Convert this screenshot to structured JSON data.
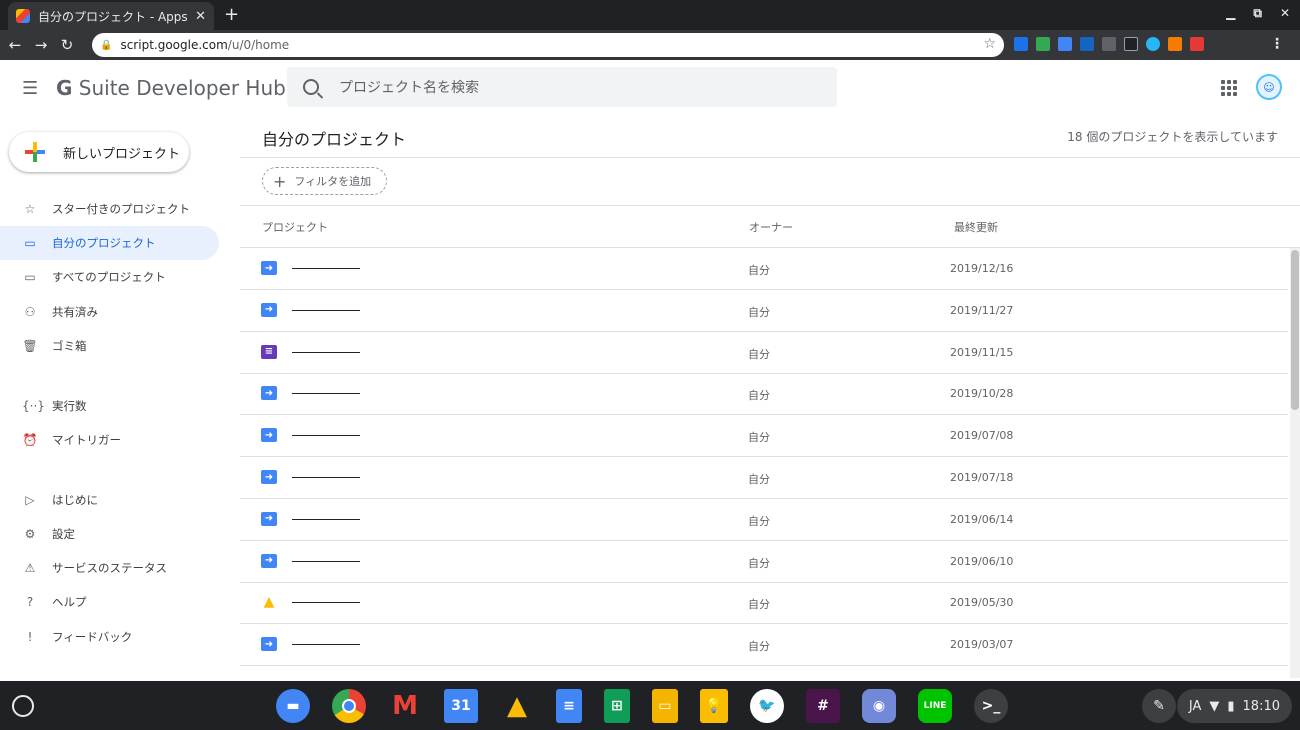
{
  "browser": {
    "tab_title": "自分のプロジェクト - Apps Sc",
    "tab_close": "✕",
    "new_tab": "+",
    "url_host": "script.google.com",
    "url_path": "/u/0/home",
    "window_controls": [
      "▁",
      "⧉",
      "✕"
    ]
  },
  "header": {
    "product_g": "G",
    "product_name": "Suite Developer Hub",
    "search_placeholder": "プロジェクト名を検索"
  },
  "sidebar": {
    "new_project_label": "新しいプロジェクト",
    "items": [
      {
        "icon": "star-icon",
        "glyph": "☆",
        "label": "スター付きのプロジェクト",
        "active": false
      },
      {
        "icon": "folder-icon",
        "glyph": "▭",
        "label": "自分のプロジェクト",
        "active": true
      },
      {
        "icon": "folder-icon",
        "glyph": "▭",
        "label": "すべてのプロジェクト",
        "active": false
      },
      {
        "icon": "people-icon",
        "glyph": "⚇",
        "label": "共有済み",
        "active": false
      },
      {
        "icon": "trash-icon",
        "glyph": "🗑",
        "label": "ゴミ箱",
        "active": false
      },
      {
        "icon": "executions-icon",
        "glyph": "{··}",
        "label": "実行数",
        "active": false
      },
      {
        "icon": "alarm-icon",
        "glyph": "⏰",
        "label": "マイトリガー",
        "active": false
      },
      {
        "icon": "play-circle-icon",
        "glyph": "▷",
        "label": "はじめに",
        "active": false
      },
      {
        "icon": "gear-icon",
        "glyph": "⚙",
        "label": "設定",
        "active": false
      },
      {
        "icon": "warning-icon",
        "glyph": "⚠",
        "label": "サービスのステータス",
        "active": false
      },
      {
        "icon": "help-icon",
        "glyph": "?",
        "label": "ヘルプ",
        "active": false
      },
      {
        "icon": "feedback-icon",
        "glyph": "!",
        "label": "フィードバック",
        "active": false
      }
    ]
  },
  "main": {
    "title": "自分のプロジェクト",
    "count_text": "18 個のプロジェクトを表示しています",
    "filter_label": "フィルタを追加",
    "columns": [
      "プロジェクト",
      "オーナー",
      "最終更新"
    ],
    "rows": [
      {
        "type": "script",
        "owner": "自分",
        "date": "2019/12/16"
      },
      {
        "type": "script",
        "owner": "自分",
        "date": "2019/11/27"
      },
      {
        "type": "forms",
        "owner": "自分",
        "date": "2019/11/15"
      },
      {
        "type": "script",
        "owner": "自分",
        "date": "2019/10/28"
      },
      {
        "type": "script",
        "owner": "自分",
        "date": "2019/07/08"
      },
      {
        "type": "script",
        "owner": "自分",
        "date": "2019/07/18"
      },
      {
        "type": "script",
        "owner": "自分",
        "date": "2019/06/14"
      },
      {
        "type": "script",
        "owner": "自分",
        "date": "2019/06/10"
      },
      {
        "type": "ads",
        "owner": "自分",
        "date": "2019/05/30"
      },
      {
        "type": "script",
        "owner": "自分",
        "date": "2019/03/07"
      }
    ]
  },
  "shelf": {
    "calendar_day": "31",
    "terminal_glyph": ">_",
    "ime": "JA",
    "time": "18:10"
  }
}
